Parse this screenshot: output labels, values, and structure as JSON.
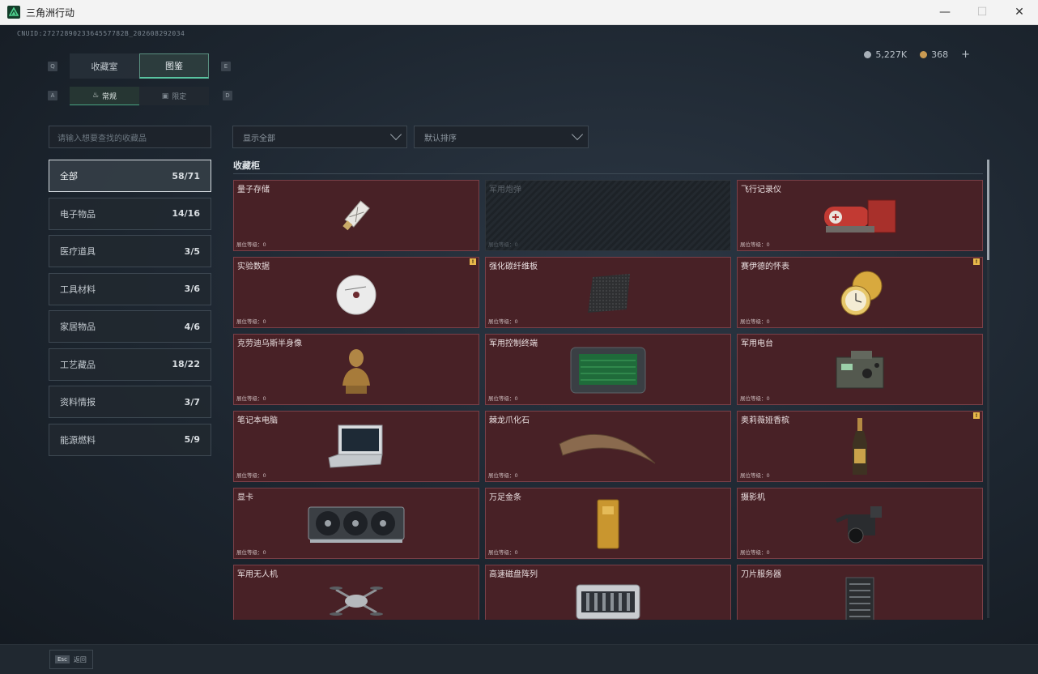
{
  "window": {
    "title": "三角洲行动",
    "minimize": "—",
    "maximize": "☐",
    "close": "✕"
  },
  "header": {
    "uid": "CNUID:2727289023364557782B_202608292034",
    "currency": [
      {
        "value": "5,227K",
        "color": "#a7b0b8"
      },
      {
        "value": "368",
        "color": "#c99a52"
      }
    ],
    "add": "+"
  },
  "key_hints": {
    "tab_left": "Q",
    "tab_right": "E",
    "sub_left": "A",
    "sub_right": "D"
  },
  "tabs": [
    {
      "label": "收藏室",
      "active": false
    },
    {
      "label": "图鉴",
      "active": true
    }
  ],
  "subtabs": [
    {
      "label": "常规",
      "active": true
    },
    {
      "label": "限定",
      "active": false
    }
  ],
  "search": {
    "placeholder": "请输入想要查找的收藏品"
  },
  "filters": {
    "show": "显示全部",
    "sort": "默认排序"
  },
  "categories": [
    {
      "label": "全部",
      "count": "58/71",
      "active": true
    },
    {
      "label": "电子物品",
      "count": "14/16",
      "active": false
    },
    {
      "label": "医疗道具",
      "count": "3/5",
      "active": false
    },
    {
      "label": "工具材料",
      "count": "3/6",
      "active": false
    },
    {
      "label": "家居物品",
      "count": "4/6",
      "active": false
    },
    {
      "label": "工艺藏品",
      "count": "18/22",
      "active": false
    },
    {
      "label": "资料情报",
      "count": "3/7",
      "active": false
    },
    {
      "label": "能源燃料",
      "count": "5/9",
      "active": false
    }
  ],
  "section": {
    "title": "收藏柜"
  },
  "level_label": "展位等级：0",
  "items": [
    {
      "name": "量子存储",
      "icon": "usb-drive-icon",
      "locked": false,
      "badge": false
    },
    {
      "name": "军用炮弹",
      "icon": "",
      "locked": true,
      "badge": false
    },
    {
      "name": "飞行记录仪",
      "icon": "flight-recorder-icon",
      "locked": false,
      "badge": false
    },
    {
      "name": "实验数据",
      "icon": "disc-icon",
      "locked": false,
      "badge": true
    },
    {
      "name": "强化碳纤维板",
      "icon": "carbon-plate-icon",
      "locked": false,
      "badge": false
    },
    {
      "name": "赛伊德的怀表",
      "icon": "pocket-watch-icon",
      "locked": false,
      "badge": true
    },
    {
      "name": "克劳迪乌斯半身像",
      "icon": "bust-icon",
      "locked": false,
      "badge": false
    },
    {
      "name": "军用控制终端",
      "icon": "terminal-icon",
      "locked": false,
      "badge": false
    },
    {
      "name": "军用电台",
      "icon": "radio-icon",
      "locked": false,
      "badge": false
    },
    {
      "name": "笔记本电脑",
      "icon": "laptop-icon",
      "locked": false,
      "badge": false
    },
    {
      "name": "棘龙爪化石",
      "icon": "claw-fossil-icon",
      "locked": false,
      "badge": false
    },
    {
      "name": "奥莉薇娅香槟",
      "icon": "champagne-icon",
      "locked": false,
      "badge": true
    },
    {
      "name": "显卡",
      "icon": "gpu-icon",
      "locked": false,
      "badge": false
    },
    {
      "name": "万足金条",
      "icon": "gold-bar-icon",
      "locked": false,
      "badge": false
    },
    {
      "name": "摄影机",
      "icon": "camera-icon",
      "locked": false,
      "badge": false
    },
    {
      "name": "军用无人机",
      "icon": "drone-icon",
      "locked": false,
      "badge": false
    },
    {
      "name": "高速磁盘阵列",
      "icon": "disk-array-icon",
      "locked": false,
      "badge": false
    },
    {
      "name": "刀片服务器",
      "icon": "server-icon",
      "locked": false,
      "badge": false
    }
  ],
  "badge_mark": "!",
  "footer": {
    "key": "Esc",
    "label": "返回"
  }
}
